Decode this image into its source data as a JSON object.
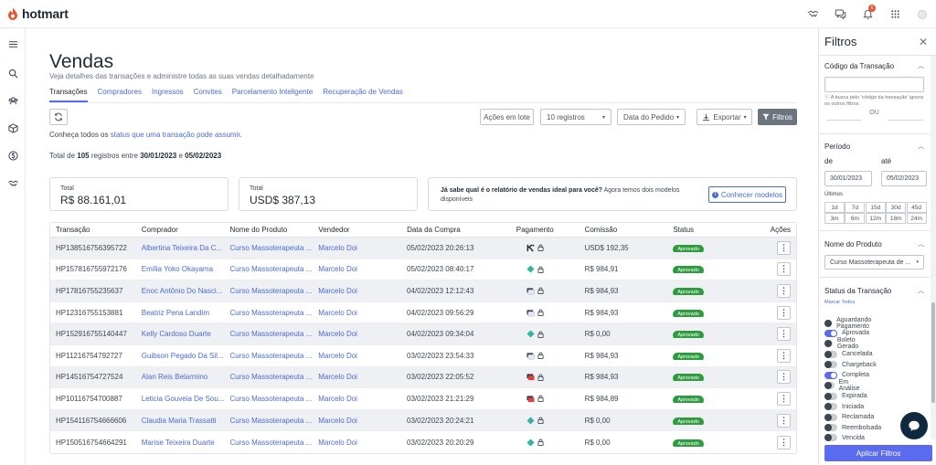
{
  "brand": {
    "name": "hotmart"
  },
  "topbar": {
    "notification_count": "6"
  },
  "page": {
    "title": "Vendas",
    "subtitle": "Veja detalhes das transações e administre todas as suas vendas detalhadamente",
    "tabs": [
      {
        "label": "Transações"
      },
      {
        "label": "Compradores"
      },
      {
        "label": "Ingressos"
      },
      {
        "label": "Convites"
      },
      {
        "label": "Parcelamento Inteligente"
      },
      {
        "label": "Recuperação de Vendas"
      }
    ]
  },
  "toolbar": {
    "acoes_label": "Ações em lote",
    "registros_label": "10 registros",
    "data_label": "Data do Pedido",
    "exportar_label": "Exportar",
    "filtros_label": "Filtros"
  },
  "info": {
    "conheca_prefix": "Conheça todos os ",
    "conheca_link": "status que uma transação pode assumir",
    "conheca_suffix": ".",
    "total_prefix": "Total de ",
    "total_count": "105",
    "total_mid": " registros entre ",
    "date_from": "30/01/2023",
    "total_and": " e ",
    "date_to": "05/02/2023"
  },
  "cards": {
    "total1_label": "Total",
    "total1_value": "R$ 88.161,01",
    "total2_label": "Total",
    "total2_value": "USD$ 387,13",
    "question_bold": "Já sabe qual é o relatório de vendas ideal para você?",
    "question_rest": " Agora temos dois modelos disponíveis",
    "conhecer_label": "Conhecer modelos"
  },
  "table": {
    "headers": [
      "Transação",
      "Comprador",
      "Nome do Produto",
      "Vendedor",
      "Data da Compra",
      "Pagamento",
      "Comissão",
      "Status",
      "Ações"
    ],
    "rows": [
      {
        "tx": "HP13851675639572​2",
        "buyer": "Albertina Teixeira Da C...",
        "product": "Curso Massoterapeuta ...",
        "seller": "Marcelo Doi",
        "date": "05/02/2023 20:26:13",
        "pay": "k-icon",
        "commission": "USD$ 192,35",
        "status": "Aprovado"
      },
      {
        "tx": "HP1578167559721​76",
        "buyer": "Emília Yoko Okayama",
        "product": "Curso Massoterapeuta ...",
        "seller": "Marcelo Doi",
        "date": "05/02/2023 08:40:17",
        "pay": "pix-icon",
        "commission": "R$ 984,91",
        "status": "Aprovado"
      },
      {
        "tx": "HP17816755235637",
        "buyer": "Enoc Antônio Do Nasci...",
        "product": "Curso Massoterapeuta ...",
        "seller": "Marcelo Doi",
        "date": "04/02/2023 12:12:43",
        "pay": "card-icon",
        "commission": "R$ 984,93",
        "status": "Aprovado"
      },
      {
        "tx": "HP12316755153881",
        "buyer": "Beatriz Pena Landim",
        "product": "Curso Massoterapeuta ...",
        "seller": "Marcelo Doi",
        "date": "04/02/2023 09:56:29",
        "pay": "card-icon",
        "commission": "R$ 984,93",
        "status": "Aprovado"
      },
      {
        "tx": "HP152916755140447",
        "buyer": "Kelly Cardoso Duarte",
        "product": "Curso Massoterapeuta ...",
        "seller": "Marcelo Doi",
        "date": "04/02/2023 09:34:04",
        "pay": "pix-icon",
        "commission": "R$ 0,00",
        "status": "Aprovado"
      },
      {
        "tx": "HP11216754792727",
        "buyer": "Guibson Pegado Da Sil...",
        "product": "Curso Massoterapeuta ...",
        "seller": "Marcelo Doi",
        "date": "03/02/2023 23:54:33",
        "pay": "card-icon",
        "commission": "R$ 984,93",
        "status": "Aprovado"
      },
      {
        "tx": "HP14516754727524",
        "buyer": "Alan Reis Belarmino",
        "product": "Curso Massoterapeuta ...",
        "seller": "Marcelo Doi",
        "date": "03/02/2023 22:05:52",
        "pay": "card2-icon",
        "commission": "R$ 984,93",
        "status": "Aprovado"
      },
      {
        "tx": "HP10116754700887",
        "buyer": "Leticia Gouveia De Sou...",
        "product": "Curso Massoterapeuta ...",
        "seller": "Marcelo Doi",
        "date": "03/02/2023 21:21:29",
        "pay": "card2-icon",
        "commission": "R$ 984,89",
        "status": "Aprovado"
      },
      {
        "tx": "HP154116754666606",
        "buyer": "Claudia Maria Trassatti",
        "product": "Curso Massoterapeuta ...",
        "seller": "Marcelo Doi",
        "date": "03/02/2023 20:24:21",
        "pay": "pix-icon",
        "commission": "R$ 0,00",
        "status": "Aprovado"
      },
      {
        "tx": "HP150516754664291",
        "buyer": "Marise Teixeira Duarte",
        "product": "Curso Massoterapeuta ...",
        "seller": "Marcelo Doi",
        "date": "03/02/2023 20:20:29",
        "pay": "pix-icon",
        "commission": "R$ 0,00",
        "status": "Aprovado"
      }
    ]
  },
  "filters": {
    "title": "Filtros",
    "codigo_label": "Código da Transação",
    "codigo_hint": "A busca pelo 'código da transação' ignora os outros filtros.",
    "ou": "OU",
    "periodo_label": "Período",
    "de_label": "de",
    "ate_label": "até",
    "de_value": "30/01/2023",
    "ate_value": "05/02/2023",
    "ultimos_label": "Últimos",
    "ranges": [
      "1d",
      "7d",
      "15d",
      "30d",
      "45d",
      "3m",
      "6m",
      "12m",
      "18m",
      "24m"
    ],
    "produto_label": "Nome do Produto",
    "produto_value": "Curso Massoterapeuta de ...",
    "status_label": "Status da Transação",
    "marcar_todos": "Marcar Todos",
    "statuses": [
      {
        "label": "Aguardando Pagamento",
        "on": false
      },
      {
        "label": "Aprovada",
        "on": true
      },
      {
        "label": "Boleto Gerado",
        "on": false
      },
      {
        "label": "Cancelada",
        "on": false
      },
      {
        "label": "Chargeback",
        "on": false
      },
      {
        "label": "Completa",
        "on": true
      },
      {
        "label": "Em Análise",
        "on": false
      },
      {
        "label": "Expirada",
        "on": false
      },
      {
        "label": "Iniciada",
        "on": false
      },
      {
        "label": "Reclamada",
        "on": false
      },
      {
        "label": "Reembolsada",
        "on": false
      },
      {
        "label": "Vencida",
        "on": false
      }
    ],
    "apply_label": "Aplicar Filtros"
  },
  "colors": {
    "accent": "#5b6bf0",
    "link": "#4a6bd8",
    "success": "#2e9c3e",
    "brand": "#e8532f"
  }
}
